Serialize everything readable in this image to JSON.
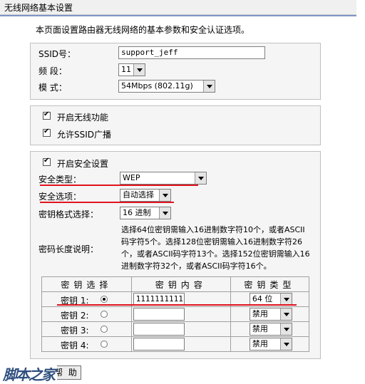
{
  "header": {
    "title": "无线网络基本设置"
  },
  "intro": "本页面设置路由器无线网络的基本参数和安全认证选项。",
  "basic": {
    "ssid_label": "SSID号：",
    "ssid_value": "support_jeff",
    "channel_label": "频  段：",
    "channel_value": "11",
    "mode_label": "模  式：",
    "mode_value": "54Mbps (802.11g)"
  },
  "wireless": {
    "enable_label": "开启无线功能",
    "broadcast_label": "允许SSID广播"
  },
  "security": {
    "enable_label": "开启安全设置",
    "type_label": "安全类型：",
    "type_value": "WEP",
    "option_label": "安全选项：",
    "option_value": "自动选择",
    "format_label": "密钥格式选择：",
    "format_value": "16 进制",
    "length_label": "密码长度说明：",
    "length_desc": [
      "选择64位密钥需输入16进制数字符10个，或者ASCII",
      "码字符5个。选择128位密钥需输入16进制数字符26",
      "个，或者ASCII码字符13个。选择152位密钥需输入16",
      "进制数字符32个，或者ASCII码字符16个。"
    ]
  },
  "keys": {
    "headers": [
      "密钥选择",
      "密钥内容",
      "密钥类型"
    ],
    "rows": [
      {
        "label": "密钥 1:",
        "value": "1111111111",
        "type": "64 位",
        "selected": true
      },
      {
        "label": "密钥 2:",
        "value": "",
        "type": "禁用",
        "selected": false
      },
      {
        "label": "密钥 3:",
        "value": "",
        "type": "禁用",
        "selected": false
      },
      {
        "label": "密钥 4:",
        "value": "",
        "type": "禁用",
        "selected": false
      }
    ]
  },
  "buttons": {
    "help": "帮 助"
  },
  "watermark": "脚本之家",
  "colors": {
    "annotation": "#e0141e",
    "separator": "#7f95c8"
  }
}
